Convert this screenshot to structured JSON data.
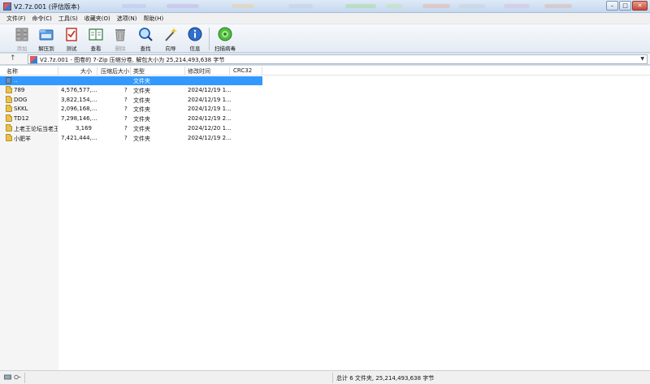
{
  "window": {
    "title": "V2.7z.001 (评估版本)",
    "controls": {
      "minimize": "–",
      "maximize": "□",
      "close": "✕"
    }
  },
  "menu": [
    {
      "label": "文件(F)"
    },
    {
      "label": "命令(C)"
    },
    {
      "label": "工具(S)"
    },
    {
      "label": "收藏夹(O)"
    },
    {
      "label": "选项(N)"
    },
    {
      "label": "帮助(H)"
    }
  ],
  "toolbar": [
    {
      "label": "添加",
      "icon": "add-archive-icon",
      "enabled": false
    },
    {
      "label": "解压到",
      "icon": "extract-to-icon",
      "enabled": true
    },
    {
      "label": "测试",
      "icon": "test-icon",
      "enabled": true
    },
    {
      "label": "查看",
      "icon": "view-icon",
      "enabled": true
    },
    {
      "label": "删除",
      "icon": "delete-icon",
      "enabled": false
    },
    {
      "label": "查找",
      "icon": "find-icon",
      "enabled": true
    },
    {
      "label": "向导",
      "icon": "wizard-icon",
      "enabled": true
    },
    {
      "label": "信息",
      "icon": "info-icon",
      "enabled": true
    },
    {
      "label": "扫描病毒",
      "icon": "virus-scan-icon",
      "enabled": true
    }
  ],
  "address": {
    "up": "↑",
    "text": "V2.7z.001 - 图卷的 7-Zip 压缩分卷, 解包大小为 25,214,493,638 字节",
    "dropdown": "▼"
  },
  "columns": {
    "name": "名称",
    "size": "大小",
    "packed": "压缩后大小",
    "type": "类型",
    "modified": "修改时间",
    "crc": "CRC32"
  },
  "rows": [
    {
      "name": "..",
      "size": "",
      "packed": "",
      "type": "文件夹",
      "modified": "",
      "selected": true,
      "kind": "parent"
    },
    {
      "name": "789",
      "size": "4,576,577,...",
      "packed": "?",
      "type": "文件夹",
      "modified": "2024/12/19 1...",
      "kind": "folder"
    },
    {
      "name": "DOG",
      "size": "3,822,154,...",
      "packed": "?",
      "type": "文件夹",
      "modified": "2024/12/19 1...",
      "kind": "folder"
    },
    {
      "name": "SKKL",
      "size": "2,096,168,...",
      "packed": "?",
      "type": "文件夹",
      "modified": "2024/12/19 1...",
      "kind": "folder"
    },
    {
      "name": "TD12",
      "size": "7,298,146,...",
      "packed": "?",
      "type": "文件夹",
      "modified": "2024/12/19 2...",
      "kind": "folder"
    },
    {
      "name": "上老王论坛当老王",
      "size": "3,169",
      "packed": "?",
      "type": "文件夹",
      "modified": "2024/12/20 1...",
      "kind": "folder"
    },
    {
      "name": "小肥羊",
      "size": "7,421,444,...",
      "packed": "?",
      "type": "文件夹",
      "modified": "2024/12/19 2...",
      "kind": "folder"
    }
  ],
  "status": {
    "summary": "总计 6 文件夹, 25,214,493,638 字节"
  },
  "colors": {
    "selection": "#3399ff",
    "toolbar_bg": "#eef2f8",
    "window_frame": "#c9dcef"
  }
}
